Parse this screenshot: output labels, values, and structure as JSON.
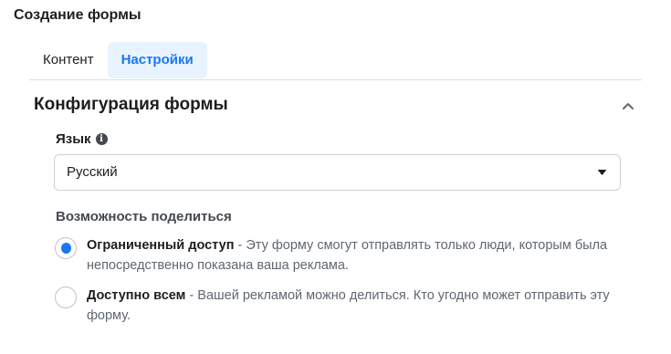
{
  "header": {
    "title": "Создание формы"
  },
  "tabs": [
    {
      "label": "Контент",
      "active": false
    },
    {
      "label": "Настройки",
      "active": true
    }
  ],
  "section": {
    "title": "Конфигурация формы",
    "collapse_icon": "chevron-up-icon"
  },
  "language": {
    "label": "Язык",
    "info_icon": "info-icon",
    "selected": "Русский",
    "caret_icon": "caret-down-icon"
  },
  "sharing": {
    "label": "Возможность поделиться",
    "options": [
      {
        "title": "Ограниченный доступ",
        "description": " - Эту форму смогут отправлять только люди, которым была непосредственно показана ваша реклама.",
        "selected": true
      },
      {
        "title": "Доступно всем",
        "description": " - Вашей рекламой можно делиться. Кто угодно может отправить эту форму.",
        "selected": false
      }
    ]
  },
  "colors": {
    "accent": "#1877f2",
    "active_tab_bg": "#e7f3ff",
    "text": "#1c1e21",
    "secondary_text": "#606770",
    "border": "#ccd0d5"
  }
}
